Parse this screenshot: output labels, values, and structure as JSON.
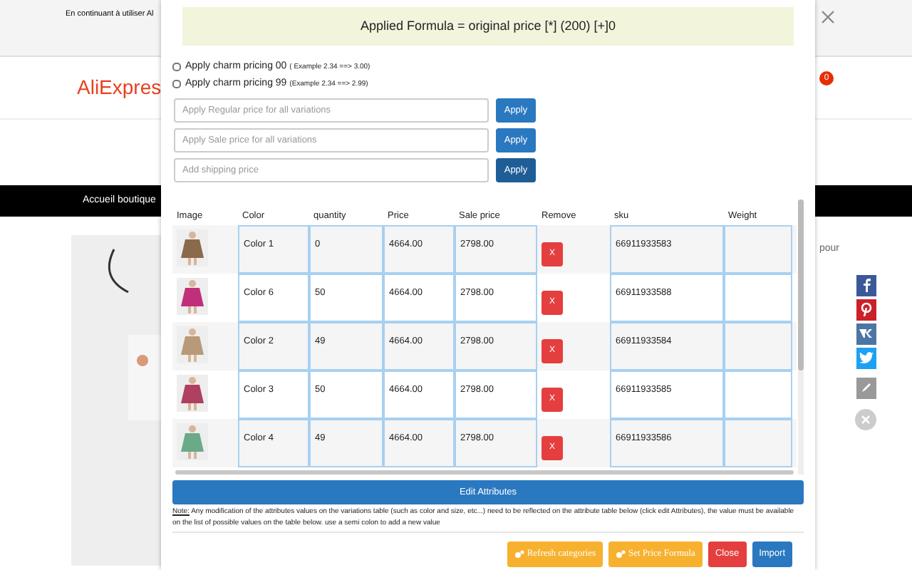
{
  "page": {
    "notice": "En continuant à utiliser Al",
    "logo": "AliExpres",
    "cart_count": "0",
    "nav_item": "Accueil boutique",
    "side_text": "pour"
  },
  "modal": {
    "formula": "Applied Formula = original price [*] (200) [+]0",
    "charm_options": [
      {
        "label": "Apply charm pricing 00",
        "example": "( Example 2.34 ==> 3.00)",
        "checked": false
      },
      {
        "label": "Apply charm pricing 99",
        "example": "(Example 2.34 ==> 2.99)",
        "checked": false
      }
    ],
    "price_fields": [
      {
        "placeholder": "Apply Regular price for all variations",
        "button": "Apply",
        "pressed": false
      },
      {
        "placeholder": "Apply Sale price for all variations",
        "button": "Apply",
        "pressed": false
      },
      {
        "placeholder": "Add shipping price",
        "button": "Apply",
        "pressed": true
      }
    ],
    "table": {
      "columns": [
        "Image",
        "Color",
        "quantity",
        "Price",
        "Sale price",
        "Remove",
        "sku",
        "Weight"
      ],
      "rows": [
        {
          "variant": "Color 1",
          "quantity": "0",
          "price": "4664.00",
          "sale_price": "2798.00",
          "remove": "X",
          "sku": "66911933583"
        },
        {
          "variant": "Color 6",
          "quantity": "50",
          "price": "4664.00",
          "sale_price": "2798.00",
          "remove": "X",
          "sku": "66911933588"
        },
        {
          "variant": "Color 2",
          "quantity": "49",
          "price": "4664.00",
          "sale_price": "2798.00",
          "remove": "X",
          "sku": "66911933584"
        },
        {
          "variant": "Color 3",
          "quantity": "50",
          "price": "4664.00",
          "sale_price": "2798.00",
          "remove": "X",
          "sku": "66911933585"
        },
        {
          "variant": "Color 4",
          "quantity": "49",
          "price": "4664.00",
          "sale_price": "2798.00",
          "remove": "X",
          "sku": "66911933586"
        }
      ]
    },
    "edit_button": "Edit Attributes",
    "note": {
      "label": "Note:",
      "text": "Any modification of the attributes values on the variations table (such as color and size, etc...) need to be reflected on the attribute table below (click edit Attributes), the value must be available on the list of possible values on the table below. use a semi colon to add a new value"
    },
    "footer_buttons": [
      {
        "label": "Refresh categories",
        "kind": "warning"
      },
      {
        "label": "Set Price Formula",
        "kind": "warning"
      },
      {
        "label": "Close",
        "kind": "danger"
      },
      {
        "label": "Import",
        "kind": "primary"
      }
    ]
  }
}
